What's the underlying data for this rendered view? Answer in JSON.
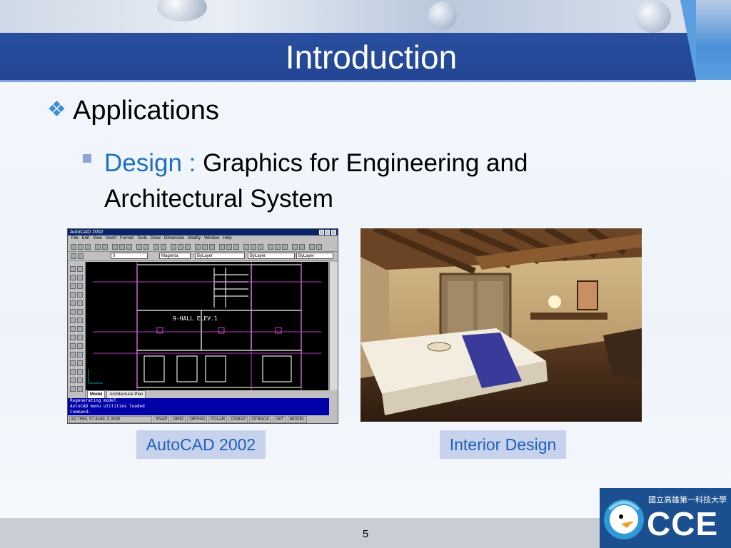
{
  "slide": {
    "title": "Introduction",
    "bullet_l1": "Applications",
    "bullet_l2_key": "Design :",
    "bullet_l2_text": " Graphics for Engineering and Architectural System",
    "captions": [
      "AutoCAD 2002",
      "Interior Design"
    ],
    "page_number": "5",
    "logo_text": "CCE",
    "logo_chinese": "國立高雄第一科技大學"
  },
  "autocad": {
    "window_title": "AutoCAD 2002",
    "menu": [
      "File",
      "Edit",
      "View",
      "Insert",
      "Format",
      "Tools",
      "Draw",
      "Dimension",
      "Modify",
      "Window",
      "Help"
    ],
    "layer_value": "0",
    "color_value": "Magenta",
    "linetype_value": "ByLayer",
    "lineweight_value": "ByLayer",
    "plotstyle_value": "ByLayer",
    "drawing_label": "9-HALL ELEV.1",
    "tabs": [
      "Model",
      "Architectural Plan"
    ],
    "command_lines": [
      "Regenerating model",
      "AutoCAD menu utilities loaded",
      "Command:"
    ],
    "coordinates": "82.7555, 57.8169, 0.0000",
    "status_buttons": [
      "SNAP",
      "GRID",
      "ORTHO",
      "POLAR",
      "OSNAP",
      "OTRACK",
      "LWT",
      "MODEL"
    ]
  },
  "colors": {
    "title_bar": "#214593",
    "accent": "#3a8fd8",
    "caption_bg": "#c7d2ec",
    "caption_text": "#1f5fb8",
    "cad_lines": "#ff4dff",
    "cad_walls": "#e6e6e6"
  }
}
